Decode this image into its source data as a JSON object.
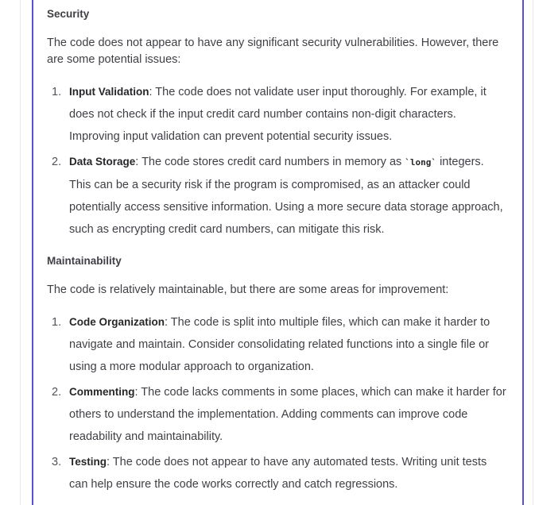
{
  "security": {
    "title": "Security",
    "intro": "The code does not appear to have any significant security vulnerabilities. However, there are some potential issues:",
    "items": [
      {
        "number": "1.",
        "term": "Input Validation",
        "text": ": The code does not validate user input thoroughly. For example, it does not check if the input credit card number contains non-digit characters. Improving input validation can prevent potential security issues."
      },
      {
        "number": "2.",
        "term": "Data Storage",
        "text_before": ": The code stores credit card numbers in memory as ",
        "code": "`long`",
        "text_after": " integers. This can be a security risk if the program is compromised, as an attacker could potentially access sensitive information. Using a more secure data storage approach, such as encrypting credit card numbers, can mitigate this risk."
      }
    ]
  },
  "maintainability": {
    "title": "Maintainability",
    "intro": "The code is relatively maintainable, but there are some areas for improvement:",
    "items": [
      {
        "number": "1.",
        "term": "Code Organization",
        "text": ": The code is split into multiple files, which can make it harder to navigate and maintain. Consider consolidating related functions into a single file or using a more modular approach to organization."
      },
      {
        "number": "2.",
        "term": "Commenting",
        "text": ": The code lacks comments in some places, which can make it harder for others to understand the implementation. Adding comments can improve code readability and maintainability."
      },
      {
        "number": "3.",
        "term": "Testing",
        "text": ": The code does not appear to have any automated tests. Writing unit tests can help ensure the code works correctly and catch regressions."
      }
    ]
  }
}
